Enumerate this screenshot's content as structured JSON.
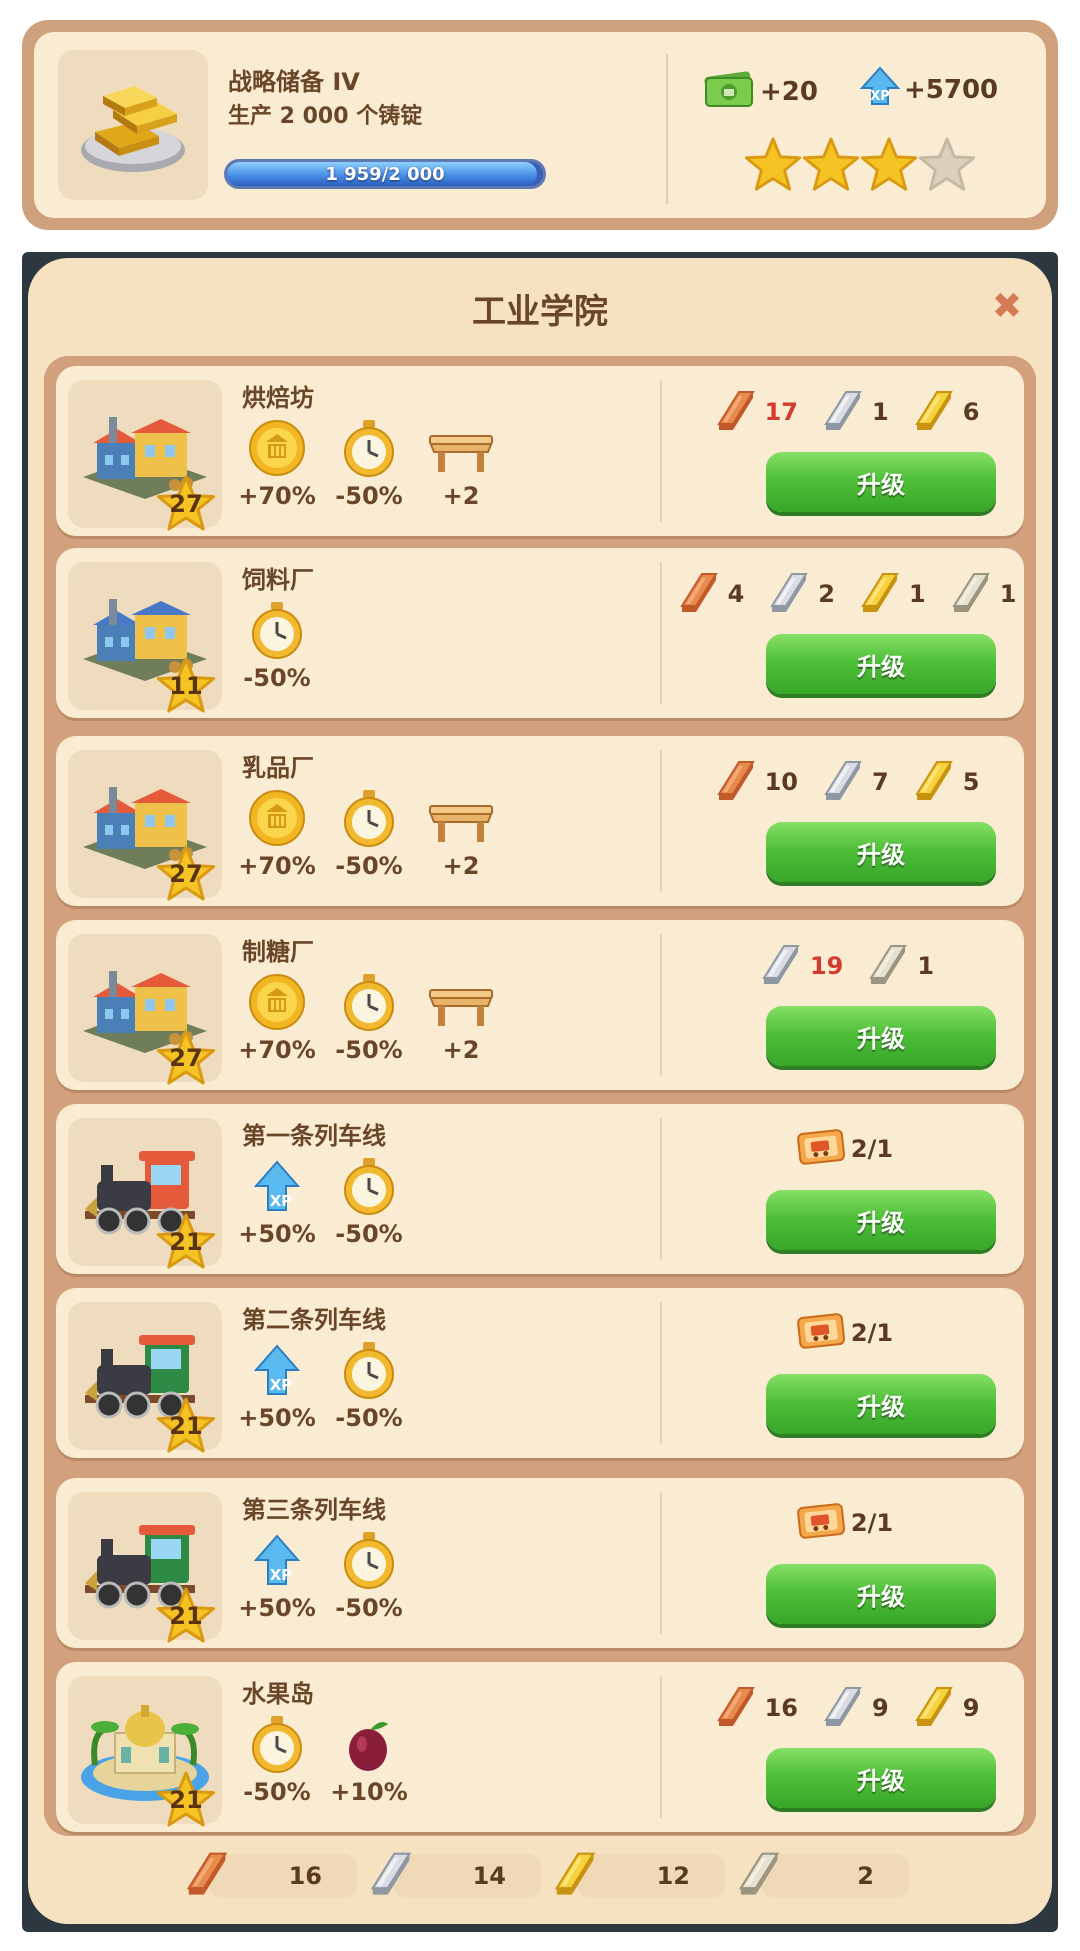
{
  "top_task": {
    "title": "战略储备 IV",
    "subtitle": "生产 2 000 个铸锭",
    "progress_text": "1 959/2 000",
    "progress_fraction": 0.9795,
    "reward_money": "+20",
    "reward_xp": "+5700",
    "stars_filled": 3,
    "stars_total": 4
  },
  "panel": {
    "title": "工业学院",
    "close_icon": "close-icon"
  },
  "buildings": [
    {
      "name": "烘焙坊",
      "level": "27",
      "stats": [
        {
          "icon": "coin-icon",
          "value": "+70%"
        },
        {
          "icon": "stopwatch-icon",
          "value": "-50%"
        },
        {
          "icon": "table-icon",
          "value": "+2"
        }
      ],
      "costs": [
        {
          "ingot": "copper",
          "value": "17",
          "red": true
        },
        {
          "ingot": "silver",
          "value": "1",
          "red": false
        },
        {
          "ingot": "gold",
          "value": "6",
          "red": false
        }
      ],
      "button": "升级",
      "thumb": "factory-icon"
    },
    {
      "name": "饲料厂",
      "level": "11",
      "stats": [
        {
          "icon": "stopwatch-icon",
          "value": "-50%"
        }
      ],
      "costs": [
        {
          "ingot": "copper",
          "value": "4",
          "red": false
        },
        {
          "ingot": "silver",
          "value": "2",
          "red": false
        },
        {
          "ingot": "gold",
          "value": "1",
          "red": false
        },
        {
          "ingot": "platinum",
          "value": "1",
          "red": false
        }
      ],
      "button": "升级",
      "thumb": "factory-icon"
    },
    {
      "name": "乳品厂",
      "level": "27",
      "stats": [
        {
          "icon": "coin-icon",
          "value": "+70%"
        },
        {
          "icon": "stopwatch-icon",
          "value": "-50%"
        },
        {
          "icon": "table-icon",
          "value": "+2"
        }
      ],
      "costs": [
        {
          "ingot": "copper",
          "value": "10",
          "red": false
        },
        {
          "ingot": "silver",
          "value": "7",
          "red": false
        },
        {
          "ingot": "gold",
          "value": "5",
          "red": false
        }
      ],
      "button": "升级",
      "thumb": "factory-icon"
    },
    {
      "name": "制糖厂",
      "level": "27",
      "stats": [
        {
          "icon": "coin-icon",
          "value": "+70%"
        },
        {
          "icon": "stopwatch-icon",
          "value": "-50%"
        },
        {
          "icon": "table-icon",
          "value": "+2"
        }
      ],
      "costs": [
        {
          "ingot": "silver",
          "value": "19",
          "red": true
        },
        {
          "ingot": "platinum",
          "value": "1",
          "red": false
        }
      ],
      "button": "升级",
      "thumb": "factory-icon"
    },
    {
      "name": "第一条列车线",
      "level": "21",
      "stats": [
        {
          "icon": "xp-icon",
          "value": "+50%"
        },
        {
          "icon": "stopwatch-icon",
          "value": "-50%"
        }
      ],
      "costs": [
        {
          "ingot": "ticket",
          "value": "2/1",
          "red": false
        }
      ],
      "button": "升级",
      "thumb": "train-icon"
    },
    {
      "name": "第二条列车线",
      "level": "21",
      "stats": [
        {
          "icon": "xp-icon",
          "value": "+50%"
        },
        {
          "icon": "stopwatch-icon",
          "value": "-50%"
        }
      ],
      "costs": [
        {
          "ingot": "ticket",
          "value": "2/1",
          "red": false
        }
      ],
      "button": "升级",
      "thumb": "train-icon"
    },
    {
      "name": "第三条列车线",
      "level": "21",
      "stats": [
        {
          "icon": "xp-icon",
          "value": "+50%"
        },
        {
          "icon": "stopwatch-icon",
          "value": "-50%"
        }
      ],
      "costs": [
        {
          "ingot": "ticket",
          "value": "2/1",
          "red": false
        }
      ],
      "button": "升级",
      "thumb": "train-icon"
    },
    {
      "name": "水果岛",
      "level": "21",
      "stats": [
        {
          "icon": "stopwatch-icon",
          "value": "-50%"
        },
        {
          "icon": "plum-icon",
          "value": "+10%"
        }
      ],
      "costs": [
        {
          "ingot": "copper",
          "value": "16",
          "red": false
        },
        {
          "ingot": "silver",
          "value": "9",
          "red": false
        },
        {
          "ingot": "gold",
          "value": "9",
          "red": false
        }
      ],
      "button": "升级",
      "thumb": "island-icon"
    }
  ],
  "inventory": [
    {
      "ingot": "copper",
      "value": "16"
    },
    {
      "ingot": "silver",
      "value": "14"
    },
    {
      "ingot": "gold",
      "value": "12"
    },
    {
      "ingot": "platinum",
      "value": "2"
    }
  ],
  "colors": {
    "copper": "#d9763b",
    "silver": "#c7ccd3",
    "gold": "#f2c230",
    "platinum": "#d8d2c2",
    "button_green": "#50c03a",
    "text_brown": "#6a4628",
    "warn_red": "#d23b2e"
  }
}
